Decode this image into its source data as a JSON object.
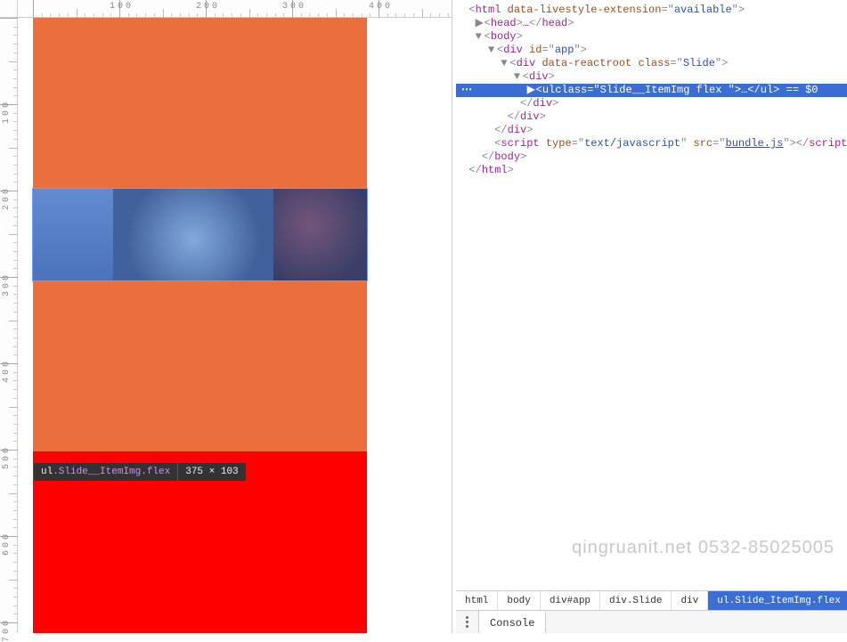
{
  "viewport": {
    "ruler_h_labels": [
      "100",
      "200",
      "300",
      "400"
    ],
    "ruler_v_labels": [
      "100",
      "200",
      "300",
      "400",
      "500",
      "600"
    ],
    "inspect_tooltip": {
      "selector_prefix": "ul",
      "selector_classes": ".Slide__ItemImg.flex",
      "dimensions": "375 × 103"
    }
  },
  "dom": {
    "line_html_open": {
      "tag": "html",
      "attr": "data-livestyle-extension",
      "val": "available"
    },
    "line_head": {
      "open": "head",
      "ellipsis": "…",
      "close": "head"
    },
    "line_body_open": {
      "tag": "body"
    },
    "line_div_app": {
      "tag": "div",
      "attr": "id",
      "val": "app"
    },
    "line_div_slide": {
      "tag": "div",
      "attr1": "data-reactroot",
      "attr2": "class",
      "val2": "Slide"
    },
    "line_div_plain": {
      "tag": "div"
    },
    "line_ul_sel": {
      "tag": "ul",
      "attr": "class",
      "val": "Slide__ItemImg flex ",
      "ellipsis": "…",
      "eqvar": " == $0"
    },
    "line_div_close": "div",
    "line_script": {
      "tag": "script",
      "attr1": "type",
      "val1": "text/javascript",
      "attr2": "src",
      "val2": "bundle.js"
    },
    "line_body_close": "body",
    "line_html_close": "html"
  },
  "breadcrumbs": [
    "html",
    "body",
    "div#app",
    "div.Slide",
    "div",
    "ul.Slide_ItemImg.flex"
  ],
  "console_tab": "Console",
  "watermark": "qingruanit.net 0532-85025005"
}
